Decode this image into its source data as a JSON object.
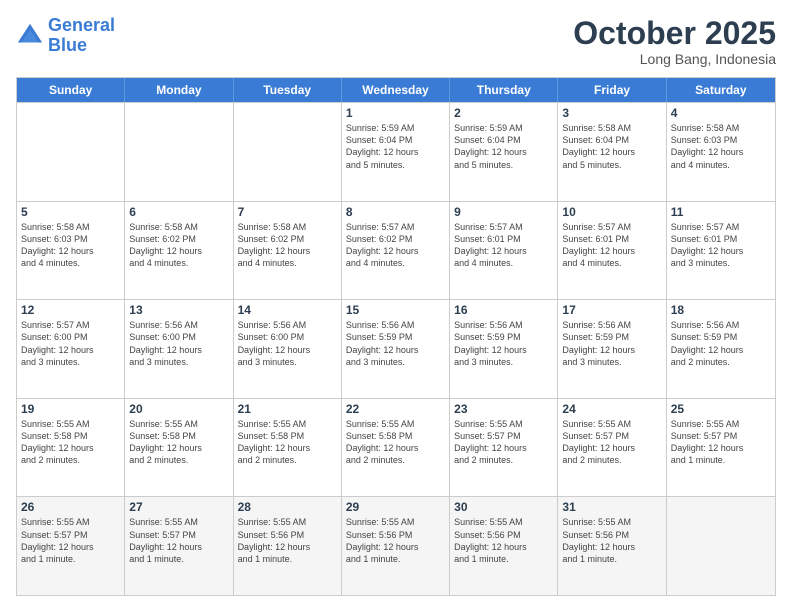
{
  "header": {
    "logo_line1": "General",
    "logo_line2": "Blue",
    "month": "October 2025",
    "location": "Long Bang, Indonesia"
  },
  "weekdays": [
    "Sunday",
    "Monday",
    "Tuesday",
    "Wednesday",
    "Thursday",
    "Friday",
    "Saturday"
  ],
  "rows": [
    [
      {
        "day": "",
        "info": ""
      },
      {
        "day": "",
        "info": ""
      },
      {
        "day": "",
        "info": ""
      },
      {
        "day": "1",
        "info": "Sunrise: 5:59 AM\nSunset: 6:04 PM\nDaylight: 12 hours\nand 5 minutes."
      },
      {
        "day": "2",
        "info": "Sunrise: 5:59 AM\nSunset: 6:04 PM\nDaylight: 12 hours\nand 5 minutes."
      },
      {
        "day": "3",
        "info": "Sunrise: 5:58 AM\nSunset: 6:04 PM\nDaylight: 12 hours\nand 5 minutes."
      },
      {
        "day": "4",
        "info": "Sunrise: 5:58 AM\nSunset: 6:03 PM\nDaylight: 12 hours\nand 4 minutes."
      }
    ],
    [
      {
        "day": "5",
        "info": "Sunrise: 5:58 AM\nSunset: 6:03 PM\nDaylight: 12 hours\nand 4 minutes."
      },
      {
        "day": "6",
        "info": "Sunrise: 5:58 AM\nSunset: 6:02 PM\nDaylight: 12 hours\nand 4 minutes."
      },
      {
        "day": "7",
        "info": "Sunrise: 5:58 AM\nSunset: 6:02 PM\nDaylight: 12 hours\nand 4 minutes."
      },
      {
        "day": "8",
        "info": "Sunrise: 5:57 AM\nSunset: 6:02 PM\nDaylight: 12 hours\nand 4 minutes."
      },
      {
        "day": "9",
        "info": "Sunrise: 5:57 AM\nSunset: 6:01 PM\nDaylight: 12 hours\nand 4 minutes."
      },
      {
        "day": "10",
        "info": "Sunrise: 5:57 AM\nSunset: 6:01 PM\nDaylight: 12 hours\nand 4 minutes."
      },
      {
        "day": "11",
        "info": "Sunrise: 5:57 AM\nSunset: 6:01 PM\nDaylight: 12 hours\nand 3 minutes."
      }
    ],
    [
      {
        "day": "12",
        "info": "Sunrise: 5:57 AM\nSunset: 6:00 PM\nDaylight: 12 hours\nand 3 minutes."
      },
      {
        "day": "13",
        "info": "Sunrise: 5:56 AM\nSunset: 6:00 PM\nDaylight: 12 hours\nand 3 minutes."
      },
      {
        "day": "14",
        "info": "Sunrise: 5:56 AM\nSunset: 6:00 PM\nDaylight: 12 hours\nand 3 minutes."
      },
      {
        "day": "15",
        "info": "Sunrise: 5:56 AM\nSunset: 5:59 PM\nDaylight: 12 hours\nand 3 minutes."
      },
      {
        "day": "16",
        "info": "Sunrise: 5:56 AM\nSunset: 5:59 PM\nDaylight: 12 hours\nand 3 minutes."
      },
      {
        "day": "17",
        "info": "Sunrise: 5:56 AM\nSunset: 5:59 PM\nDaylight: 12 hours\nand 3 minutes."
      },
      {
        "day": "18",
        "info": "Sunrise: 5:56 AM\nSunset: 5:59 PM\nDaylight: 12 hours\nand 2 minutes."
      }
    ],
    [
      {
        "day": "19",
        "info": "Sunrise: 5:55 AM\nSunset: 5:58 PM\nDaylight: 12 hours\nand 2 minutes."
      },
      {
        "day": "20",
        "info": "Sunrise: 5:55 AM\nSunset: 5:58 PM\nDaylight: 12 hours\nand 2 minutes."
      },
      {
        "day": "21",
        "info": "Sunrise: 5:55 AM\nSunset: 5:58 PM\nDaylight: 12 hours\nand 2 minutes."
      },
      {
        "day": "22",
        "info": "Sunrise: 5:55 AM\nSunset: 5:58 PM\nDaylight: 12 hours\nand 2 minutes."
      },
      {
        "day": "23",
        "info": "Sunrise: 5:55 AM\nSunset: 5:57 PM\nDaylight: 12 hours\nand 2 minutes."
      },
      {
        "day": "24",
        "info": "Sunrise: 5:55 AM\nSunset: 5:57 PM\nDaylight: 12 hours\nand 2 minutes."
      },
      {
        "day": "25",
        "info": "Sunrise: 5:55 AM\nSunset: 5:57 PM\nDaylight: 12 hours\nand 1 minute."
      }
    ],
    [
      {
        "day": "26",
        "info": "Sunrise: 5:55 AM\nSunset: 5:57 PM\nDaylight: 12 hours\nand 1 minute."
      },
      {
        "day": "27",
        "info": "Sunrise: 5:55 AM\nSunset: 5:57 PM\nDaylight: 12 hours\nand 1 minute."
      },
      {
        "day": "28",
        "info": "Sunrise: 5:55 AM\nSunset: 5:56 PM\nDaylight: 12 hours\nand 1 minute."
      },
      {
        "day": "29",
        "info": "Sunrise: 5:55 AM\nSunset: 5:56 PM\nDaylight: 12 hours\nand 1 minute."
      },
      {
        "day": "30",
        "info": "Sunrise: 5:55 AM\nSunset: 5:56 PM\nDaylight: 12 hours\nand 1 minute."
      },
      {
        "day": "31",
        "info": "Sunrise: 5:55 AM\nSunset: 5:56 PM\nDaylight: 12 hours\nand 1 minute."
      },
      {
        "day": "",
        "info": ""
      }
    ]
  ]
}
